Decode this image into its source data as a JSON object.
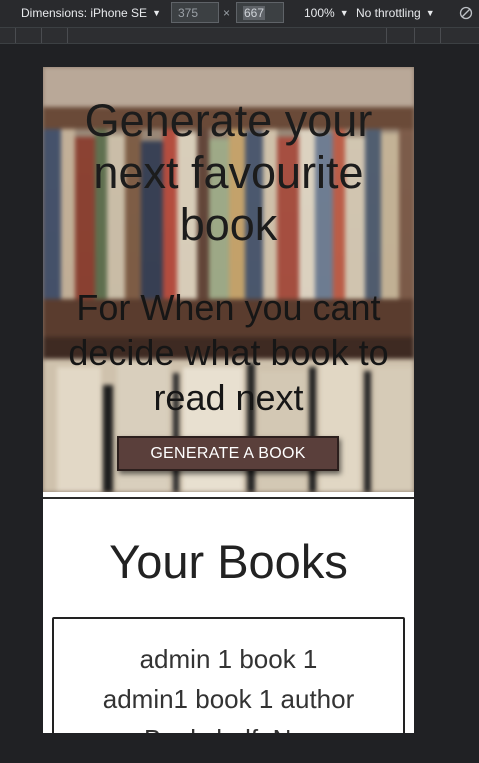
{
  "devtools": {
    "device_label": "Dimensions: iPhone SE",
    "width_value": "375",
    "height_value": "667",
    "times": "×",
    "zoom_label": "100%",
    "throttling_label": "No throttling",
    "caret": "▼"
  },
  "hero": {
    "title": "Generate your next favourite book",
    "subtitle": "For When you cant decide what book to read next",
    "button_label": "GENERATE A BOOK"
  },
  "books": {
    "heading": "Your Books",
    "items": [
      {
        "title": "admin 1 book 1",
        "author": "admin1 book 1 author",
        "partial_line": "Bookshelf: N..."
      }
    ]
  },
  "colors": {
    "devtools_bg": "#292a2d",
    "page_bg": "#202124",
    "button_bg": "#5a3f3b",
    "button_text": "#ffffff"
  }
}
